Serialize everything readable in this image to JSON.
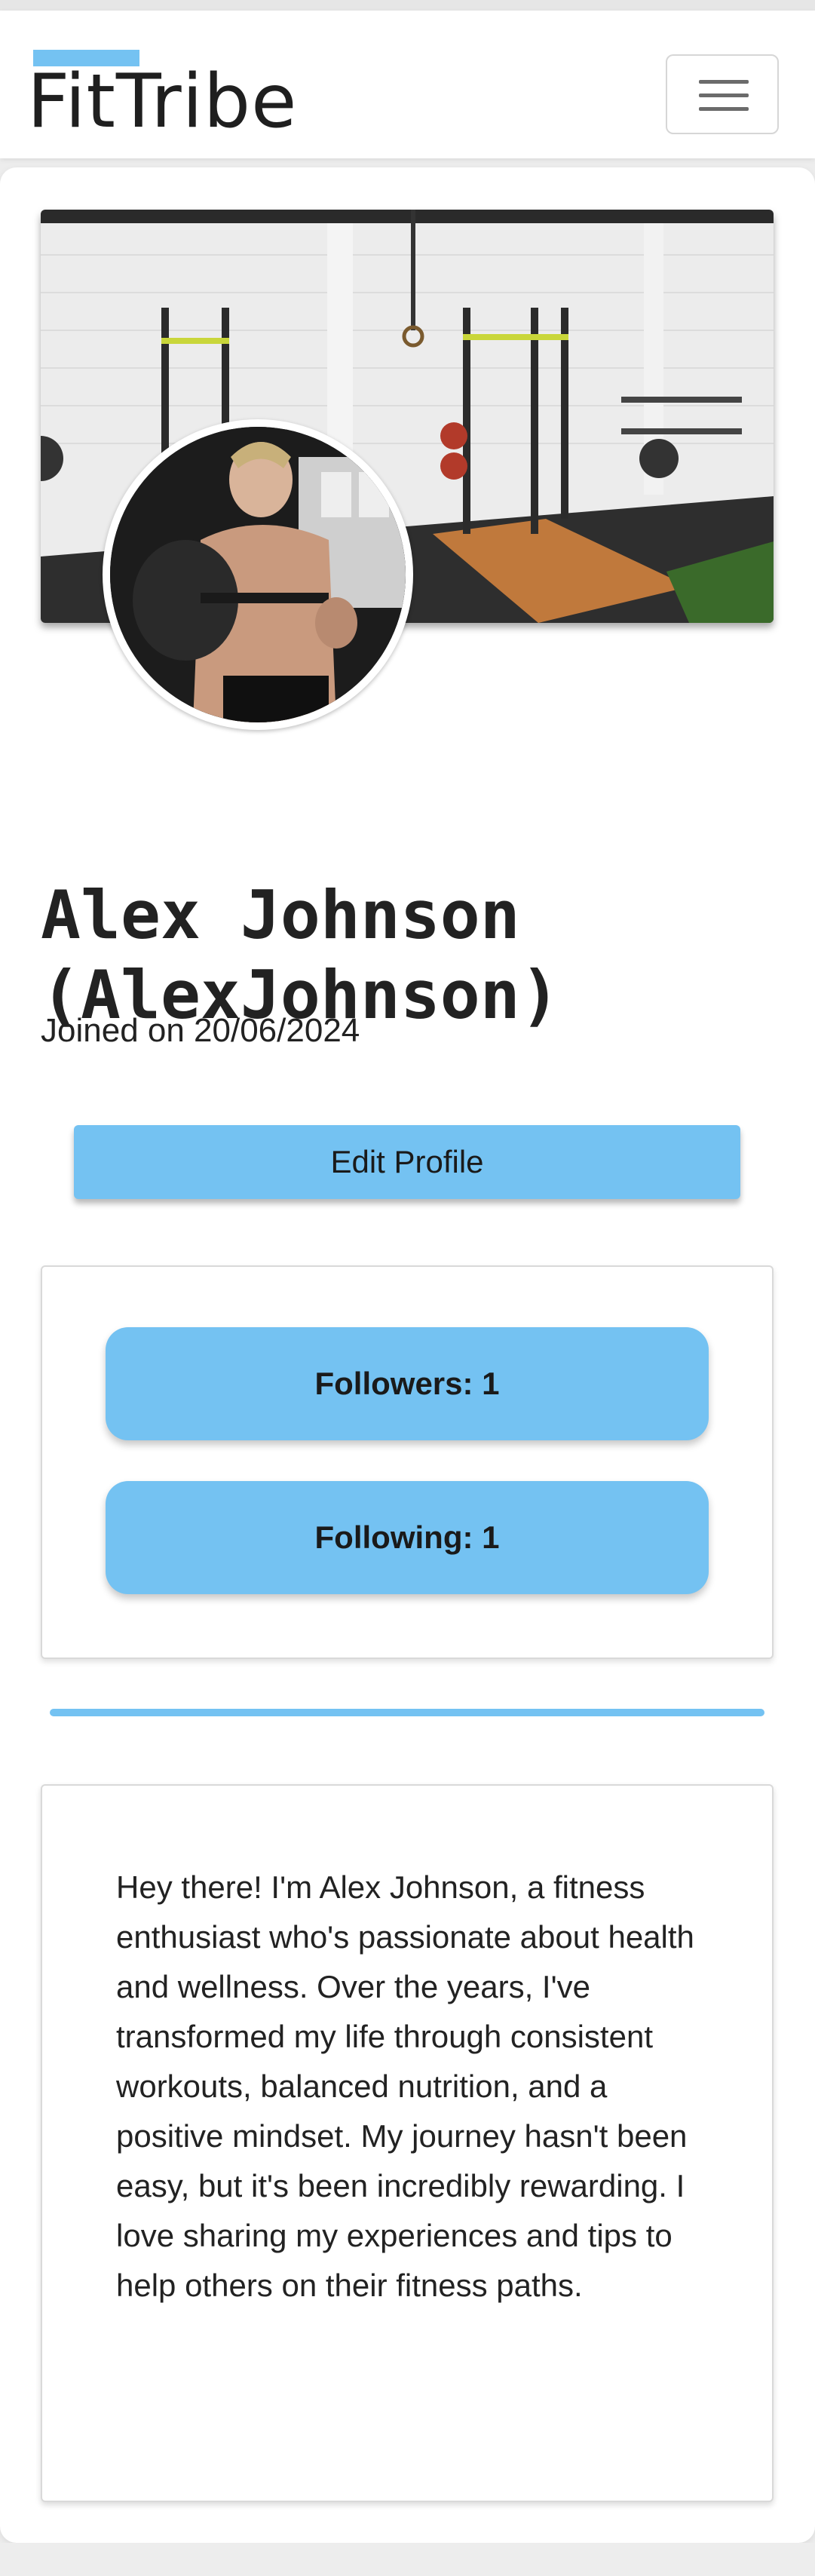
{
  "navbar": {
    "brand": "FitTribe",
    "menu_icon": "hamburger-menu-icon"
  },
  "profile": {
    "cover_image": "gym-interior-photo",
    "avatar_image": "athlete-lifting-kettlebell-photo",
    "name_line1": "Alex Johnson",
    "name_line2": "(AlexJohnson)",
    "joined": "Joined on 20/06/2024",
    "edit_label": "Edit Profile"
  },
  "stats": {
    "followers_label": "Followers: 1",
    "following_label": "Following: 1"
  },
  "bio": {
    "text": "Hey there! I'm Alex Johnson, a fitness enthusiast who's passionate about health and wellness. Over the years, I've transformed my life through consistent workouts, balanced nutrition, and a positive mindset. My journey hasn't been easy, but it's been incredibly rewarding. I love sharing my experiences and tips to help others on their fitness paths."
  },
  "colors": {
    "accent": "#74c2f2",
    "text": "#222222",
    "page_background": "#ededed"
  }
}
